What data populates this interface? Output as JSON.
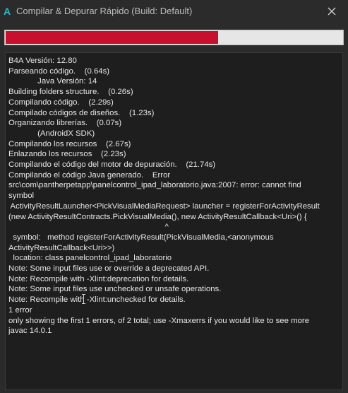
{
  "window": {
    "app_icon_glyph": "A",
    "title": "Compilar & Depurar Rápido (Build: Default)",
    "close_icon": "close-icon",
    "accent_color": "#2fb8c8"
  },
  "progress": {
    "value_fraction": 0.63,
    "fill_color": "#c8102e"
  },
  "log": {
    "lines": [
      "B4A Versión: 12.80",
      "Parseando código.    (0.64s)",
      "             Java Versión: 14",
      "Building folders structure.    (0.26s)",
      "Compilando código.    (2.29s)",
      "Compilado códigos de diseños.    (1.23s)",
      "Organizando librerías.    (0.07s)",
      "             (AndroidX SDK)",
      "Compilando los recursos    (2.67s)",
      "Enlazando los recursos    (2.23s)",
      "Compilando el código del motor de depuración.    (21.74s)",
      "Compilando el código Java generado.    Error",
      "src\\com\\pantherpetapp\\panelcontrol_ipad_laboratorio.java:2007: error: cannot find",
      "symbol",
      " ActivityResultLauncher<PickVisualMediaRequest> launcher = registerForActivityResult",
      "(new ActivityResultContracts.PickVisualMedia(), new ActivityResultCallback<Uri>() {",
      "                                                                      ^",
      "  symbol:   method registerForActivityResult(PickVisualMedia,<anonymous",
      "ActivityResultCallback<Uri>>)",
      "  location: class panelcontrol_ipad_laboratorio",
      "Note: Some input files use or override a deprecated API.",
      "Note: Recompile with -Xlint:deprecation for details.",
      "Note: Some input files use unchecked or unsafe operations.",
      "Note: Recompile with -Xlint:unchecked for details.",
      "1 error",
      "only showing the first 1 errors, of 2 total; use -Xmaxerrs if you would like to see more",
      "",
      "javac 14.0.1"
    ]
  }
}
